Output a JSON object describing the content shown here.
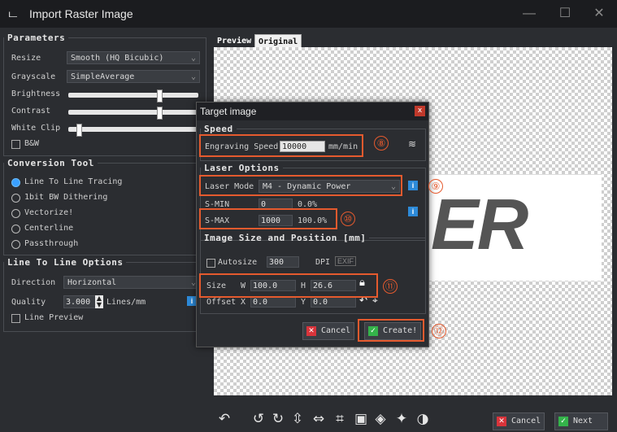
{
  "window": {
    "title": "Import Raster Image",
    "minimize": "—",
    "maximize": "☐",
    "close": "✕"
  },
  "parameters": {
    "legend": "Parameters",
    "resize_label": "Resize",
    "resize_value": "Smooth (HQ Bicubic)",
    "grayscale_label": "Grayscale",
    "grayscale_value": "SimpleAverage",
    "brightness_label": "Brightness",
    "brightness_level": 0.7,
    "contrast_label": "Contrast",
    "contrast_level": 0.7,
    "whiteclip_label": "White Clip",
    "whiteclip_level": 0.08,
    "bw_label": "B&W"
  },
  "conversion": {
    "legend": "Conversion Tool",
    "options": [
      "Line To Line Tracing",
      "1bit BW Dithering",
      "Vectorize!",
      "Centerline",
      "Passthrough"
    ],
    "selected": 0
  },
  "line_options": {
    "legend": "Line To Line Options",
    "direction_label": "Direction",
    "direction_value": "Horizontal",
    "quality_label": "Quality",
    "quality_value": "3.000",
    "quality_unit": "Lines/mm",
    "line_preview_label": "Line Preview"
  },
  "preview_tabs": [
    "Preview",
    "Original"
  ],
  "preview_logo_text": "ER",
  "dialog": {
    "title": "Target image",
    "close": "x",
    "speed_legend": "Speed",
    "engraving_speed_label": "Engraving Speed",
    "engraving_speed_value": "10000",
    "speed_unit": "mm/min",
    "laser_legend": "Laser Options",
    "laser_mode_label": "Laser Mode",
    "laser_mode_value": "M4 - Dynamic Power",
    "smin_label": "S-MIN",
    "smin_value": "0",
    "smin_pct": "0.0%",
    "smax_label": "S-MAX",
    "smax_value": "1000",
    "smax_pct": "100.0%",
    "size_legend": "Image Size and Position [mm]",
    "autosize_label": "Autosize",
    "dpi_value": "300",
    "dpi_label": "DPI",
    "exif_label": "EXIF",
    "size_label": "Size",
    "w_label": "W",
    "w_value": "100.0",
    "h_label": "H",
    "h_value": "26.6",
    "offset_label": "Offset",
    "x_label": "X",
    "x_value": "0.0",
    "y_label": "Y",
    "y_value": "0.0",
    "cancel_label": "Cancel",
    "create_label": "Create!"
  },
  "callouts": [
    "⑧",
    "⑨",
    "⑩",
    "⑪",
    "⑫"
  ],
  "bottom": {
    "cancel_label": "Cancel",
    "next_label": "Next"
  },
  "colors": {
    "accent": "#e55a2e",
    "cancel_red": "#d9343b",
    "ok_green": "#34b34a",
    "info_blue": "#2d8ad8"
  }
}
